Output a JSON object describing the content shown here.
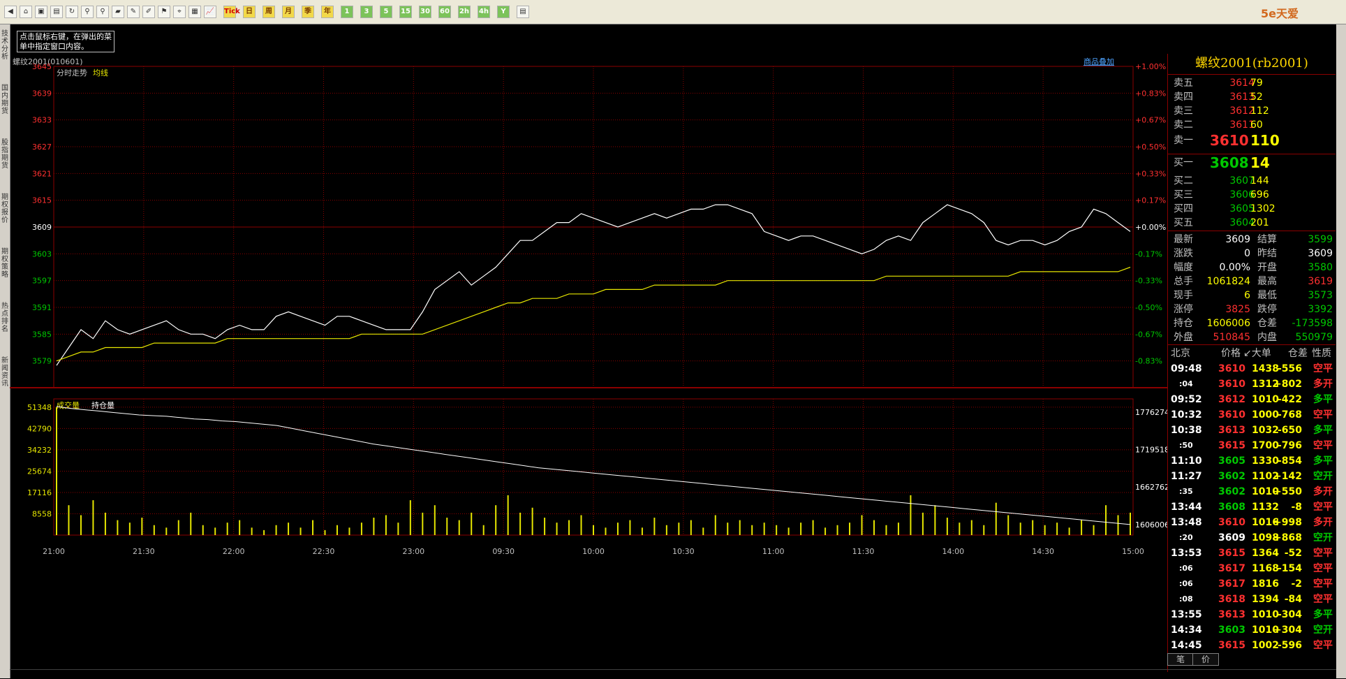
{
  "toolbar": {
    "buttons": [
      "◀",
      "⌂",
      "▣",
      "▤",
      "↻",
      "⚲",
      "⚲",
      "▰",
      "✎",
      "✐",
      "⚑",
      "⌖",
      "▦",
      "📈",
      "Tick",
      "日",
      "周",
      "月",
      "季",
      "年",
      "1",
      "3",
      "5",
      "15",
      "30",
      "60",
      "2h",
      "4h",
      "Y",
      "▤"
    ],
    "logo_text": "5e天爱"
  },
  "left_tabs": [
    "技术分析",
    "国内期货",
    "股指期货",
    "期权报价",
    "期权策略",
    "热点排名",
    "新闻资讯"
  ],
  "hint": "点击鼠标右键，在弹出的菜单中指定窗口内容。",
  "chart": {
    "title": "螺纹2001(010601)",
    "overlay_link": "商品叠加",
    "legend_price": "分时走势",
    "legend_avg": "均线",
    "legend_vol": "成交量",
    "legend_oi": "持仓量",
    "colors": {
      "grid": "#8b0000",
      "price": "#ffffff",
      "avg": "#e6e600",
      "up": "#ff3030",
      "down": "#00c800",
      "flat": "#ffffff",
      "vol": "#e6e600"
    }
  },
  "chart_data": {
    "type": "line",
    "price_axis": {
      "ticks": [
        3645,
        3639,
        3633,
        3627,
        3621,
        3615,
        3609,
        3603,
        3597,
        3591,
        3585,
        3579
      ],
      "ref": 3609,
      "ylim": [
        3575,
        3645
      ]
    },
    "pct_axis": [
      "+1.00%",
      "+0.83%",
      "+0.67%",
      "+0.50%",
      "+0.33%",
      "+0.17%",
      "+0.00%",
      "-0.17%",
      "-0.33%",
      "-0.50%",
      "-0.67%",
      "-0.83%"
    ],
    "x_ticks": [
      "21:00",
      "21:30",
      "22:00",
      "22:30",
      "23:00",
      "09:30",
      "10:00",
      "10:30",
      "11:00",
      "11:30",
      "14:00",
      "14:30",
      "15:00"
    ],
    "vol_axis": {
      "ticks": [
        51348,
        42790,
        34232,
        25674,
        17116,
        8558
      ],
      "ylim": [
        0,
        53000
      ]
    },
    "oi_axis": {
      "ticks": [
        1776274,
        1719518,
        1662762,
        1606006
      ]
    },
    "price_series": [
      3578,
      3582,
      3586,
      3584,
      3588,
      3586,
      3585,
      3586,
      3587,
      3588,
      3586,
      3585,
      3585,
      3584,
      3586,
      3587,
      3586,
      3586,
      3589,
      3590,
      3589,
      3588,
      3587,
      3589,
      3589,
      3588,
      3587,
      3586,
      3586,
      3586,
      3590,
      3595,
      3597,
      3599,
      3596,
      3598,
      3600,
      3603,
      3606,
      3606,
      3608,
      3610,
      3610,
      3612,
      3611,
      3610,
      3609,
      3610,
      3611,
      3612,
      3611,
      3612,
      3613,
      3613,
      3614,
      3614,
      3613,
      3612,
      3608,
      3607,
      3606,
      3607,
      3607,
      3606,
      3605,
      3604,
      3603,
      3604,
      3606,
      3607,
      3606,
      3610,
      3612,
      3614,
      3613,
      3612,
      3610,
      3606,
      3605,
      3606,
      3606,
      3605,
      3606,
      3608,
      3609,
      3613,
      3612,
      3610,
      3608
    ],
    "avg_series": [
      3579,
      3580,
      3581,
      3581,
      3582,
      3582,
      3582,
      3582,
      3583,
      3583,
      3583,
      3583,
      3583,
      3583,
      3584,
      3584,
      3584,
      3584,
      3584,
      3584,
      3584,
      3584,
      3584,
      3584,
      3584,
      3585,
      3585,
      3585,
      3585,
      3585,
      3585,
      3586,
      3587,
      3588,
      3589,
      3590,
      3591,
      3592,
      3592,
      3593,
      3593,
      3593,
      3594,
      3594,
      3594,
      3595,
      3595,
      3595,
      3595,
      3596,
      3596,
      3596,
      3596,
      3596,
      3596,
      3597,
      3597,
      3597,
      3597,
      3597,
      3597,
      3597,
      3597,
      3597,
      3597,
      3597,
      3597,
      3597,
      3598,
      3598,
      3598,
      3598,
      3598,
      3598,
      3598,
      3598,
      3598,
      3598,
      3598,
      3599,
      3599,
      3599,
      3599,
      3599,
      3599,
      3599,
      3599,
      3599,
      3600
    ],
    "oi_series": [
      1785000,
      1782000,
      1780000,
      1778000,
      1776000,
      1774000,
      1772000,
      1771000,
      1770000,
      1768000,
      1766000,
      1765000,
      1763000,
      1762000,
      1760000,
      1758000,
      1756000,
      1752000,
      1748000,
      1744000,
      1740000,
      1736000,
      1732000,
      1728000,
      1725000,
      1722000,
      1719000,
      1716000,
      1713000,
      1710000,
      1707000,
      1704000,
      1701000,
      1698000,
      1695000,
      1692000,
      1690000,
      1688000,
      1686000,
      1684000,
      1682000,
      1680000,
      1678000,
      1676000,
      1674000,
      1672000,
      1670000,
      1668000,
      1666000,
      1664000,
      1662000,
      1660000,
      1658000,
      1656000,
      1654000,
      1652000,
      1650000,
      1648000,
      1646000,
      1644000,
      1642000,
      1640000,
      1638000,
      1636000,
      1634000,
      1632000,
      1630000,
      1628000,
      1626000,
      1624000,
      1622000,
      1620000,
      1618000,
      1616000,
      1614000,
      1612000,
      1610000,
      1608000,
      1606006
    ],
    "vol_series": [
      51348,
      12000,
      8000,
      14000,
      9000,
      6000,
      5000,
      7000,
      4000,
      3000,
      6000,
      9000,
      4000,
      3000,
      5000,
      6000,
      3000,
      2000,
      4000,
      5000,
      3000,
      6000,
      2000,
      4000,
      3000,
      5000,
      7000,
      8000,
      5000,
      14000,
      9000,
      12000,
      7000,
      6000,
      9000,
      4000,
      12000,
      16000,
      9000,
      11000,
      7000,
      5000,
      6000,
      8000,
      4000,
      3000,
      5000,
      6000,
      3000,
      7000,
      4000,
      5000,
      6000,
      3000,
      8000,
      5000,
      6000,
      4000,
      5000,
      4000,
      3000,
      5000,
      6000,
      3000,
      4000,
      5000,
      8000,
      6000,
      4000,
      5000,
      16000,
      9000,
      12000,
      7000,
      5000,
      6000,
      4000,
      13000,
      8000,
      5000,
      6000,
      4000,
      5000,
      3000,
      6000,
      4000,
      12000,
      8000,
      9000
    ]
  },
  "quote": {
    "title": "螺纹2001(rb2001)",
    "asks": [
      {
        "name": "卖五",
        "price": "3614",
        "vol": "79"
      },
      {
        "name": "卖四",
        "price": "3613",
        "vol": "52"
      },
      {
        "name": "卖三",
        "price": "3612",
        "vol": "112"
      },
      {
        "name": "卖二",
        "price": "3611",
        "vol": "60"
      },
      {
        "name": "卖一",
        "price": "3610",
        "vol": "110"
      }
    ],
    "bids": [
      {
        "name": "买一",
        "price": "3608",
        "vol": "14"
      },
      {
        "name": "买二",
        "price": "3607",
        "vol": "144"
      },
      {
        "name": "买三",
        "price": "3606",
        "vol": "696"
      },
      {
        "name": "买四",
        "price": "3605",
        "vol": "1302"
      },
      {
        "name": "买五",
        "price": "3604",
        "vol": "201"
      }
    ],
    "stats": [
      {
        "l1": "最新",
        "v1": "3609",
        "c1": "#ffffff",
        "l2": "结算",
        "v2": "3599",
        "c2": "#00c800"
      },
      {
        "l1": "涨跌",
        "v1": "0",
        "c1": "#ffffff",
        "l2": "昨结",
        "v2": "3609",
        "c2": "#ffffff"
      },
      {
        "l1": "幅度",
        "v1": "0.00%",
        "c1": "#ffffff",
        "l2": "开盘",
        "v2": "3580",
        "c2": "#00c800"
      },
      {
        "l1": "总手",
        "v1": "1061824",
        "c1": "#ffff00",
        "l2": "最高",
        "v2": "3619",
        "c2": "#ff3030"
      },
      {
        "l1": "现手",
        "v1": "6",
        "c1": "#ffff00",
        "l2": "最低",
        "v2": "3573",
        "c2": "#00c800"
      },
      {
        "l1": "涨停",
        "v1": "3825",
        "c1": "#ff3030",
        "l2": "跌停",
        "v2": "3392",
        "c2": "#00c800"
      },
      {
        "l1": "持仓",
        "v1": "1606006",
        "c1": "#ffff00",
        "l2": "仓差",
        "v2": "-173598",
        "c2": "#00c800"
      },
      {
        "l1": "外盘",
        "v1": "510845",
        "c1": "#ff3030",
        "l2": "内盘",
        "v2": "550979",
        "c2": "#00c800"
      }
    ],
    "ticks_header": {
      "t": "北京",
      "p": "价格",
      "v": "↙大单",
      "d": "仓差",
      "n": "性质"
    },
    "ticks": [
      {
        "t": "09:48",
        "p": "3610",
        "pc": "#ff3030",
        "v": "1438",
        "d": "-556",
        "n": "空平",
        "nc": "#ff3030"
      },
      {
        "t": ":04",
        "p": "3610",
        "pc": "#ff3030",
        "v": "1312",
        "d": "+802",
        "n": "多开",
        "nc": "#ff3030"
      },
      {
        "t": "09:52",
        "p": "3612",
        "pc": "#ff3030",
        "v": "1010",
        "d": "-422",
        "n": "多平",
        "nc": "#00c800"
      },
      {
        "t": "10:32",
        "p": "3610",
        "pc": "#ff3030",
        "v": "1000",
        "d": "-768",
        "n": "空平",
        "nc": "#ff3030"
      },
      {
        "t": "10:38",
        "p": "3613",
        "pc": "#ff3030",
        "v": "1032",
        "d": "-650",
        "n": "多平",
        "nc": "#00c800"
      },
      {
        "t": ":50",
        "p": "3615",
        "pc": "#ff3030",
        "v": "1700",
        "d": "-796",
        "n": "空平",
        "nc": "#ff3030"
      },
      {
        "t": "11:10",
        "p": "3605",
        "pc": "#00c800",
        "v": "1330",
        "d": "-854",
        "n": "多平",
        "nc": "#00c800"
      },
      {
        "t": "11:27",
        "p": "3602",
        "pc": "#00c800",
        "v": "1102",
        "d": "+142",
        "n": "空开",
        "nc": "#00c800"
      },
      {
        "t": ":35",
        "p": "3602",
        "pc": "#00c800",
        "v": "1010",
        "d": "+550",
        "n": "多开",
        "nc": "#ff3030"
      },
      {
        "t": "13:44",
        "p": "3608",
        "pc": "#00c800",
        "v": "1132",
        "d": "-8",
        "n": "空平",
        "nc": "#ff3030"
      },
      {
        "t": "13:48",
        "p": "3610",
        "pc": "#ff3030",
        "v": "1016",
        "d": "+998",
        "n": "多开",
        "nc": "#ff3030"
      },
      {
        "t": ":20",
        "p": "3609",
        "pc": "#ffffff",
        "v": "1098",
        "d": "+868",
        "n": "空开",
        "nc": "#00c800"
      },
      {
        "t": "13:53",
        "p": "3615",
        "pc": "#ff3030",
        "v": "1364",
        "d": "-52",
        "n": "空平",
        "nc": "#ff3030"
      },
      {
        "t": ":06",
        "p": "3617",
        "pc": "#ff3030",
        "v": "1168",
        "d": "-154",
        "n": "空平",
        "nc": "#ff3030"
      },
      {
        "t": ":06",
        "p": "3617",
        "pc": "#ff3030",
        "v": "1816",
        "d": "-2",
        "n": "空平",
        "nc": "#ff3030"
      },
      {
        "t": ":08",
        "p": "3618",
        "pc": "#ff3030",
        "v": "1394",
        "d": "-84",
        "n": "空平",
        "nc": "#ff3030"
      },
      {
        "t": "13:55",
        "p": "3613",
        "pc": "#ff3030",
        "v": "1010",
        "d": "-304",
        "n": "多平",
        "nc": "#00c800"
      },
      {
        "t": "14:34",
        "p": "3603",
        "pc": "#00c800",
        "v": "1010",
        "d": "+304",
        "n": "空开",
        "nc": "#00c800"
      },
      {
        "t": "14:45",
        "p": "3615",
        "pc": "#ff3030",
        "v": "1002",
        "d": "-596",
        "n": "空平",
        "nc": "#ff3030"
      }
    ],
    "tabs": [
      "笔",
      "价"
    ]
  }
}
